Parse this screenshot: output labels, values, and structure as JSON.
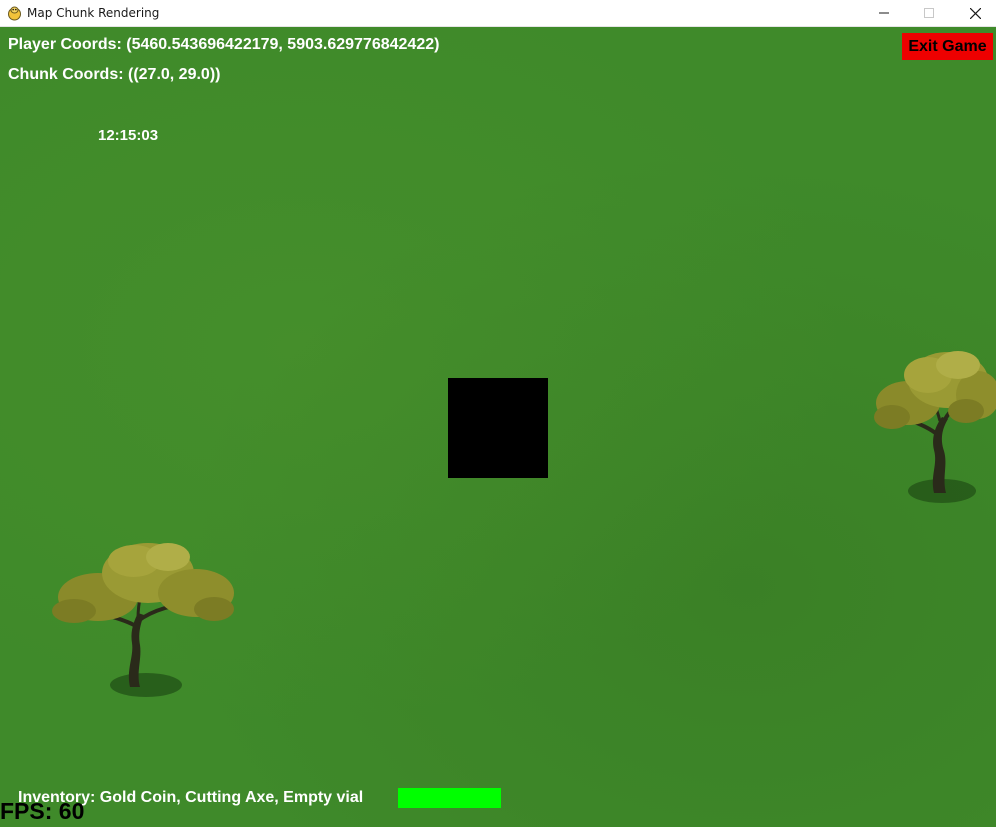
{
  "window": {
    "title": "Map Chunk Rendering",
    "icon": "pygame-snake-icon",
    "controls": [
      "minimize",
      "maximize",
      "close"
    ]
  },
  "hud": {
    "player_coords": "Player Coords: (5460.543696422179, 5903.629776842422)",
    "chunk_coords": "Chunk Coords: ((27.0, 29.0))",
    "time": "12:15:03",
    "exit_label": "Exit Game",
    "inventory": "Inventory: Gold Coin, Cutting Axe, Empty vial",
    "fps": "FPS: 60",
    "health_fraction": 1.0
  },
  "colors": {
    "grass": "#3f8a2a",
    "exit_button": "#ee0000",
    "player": "#000000",
    "health": "#00ff00",
    "hud_text": "#ffffff"
  },
  "world": {
    "objects": [
      "tree",
      "tree"
    ]
  }
}
